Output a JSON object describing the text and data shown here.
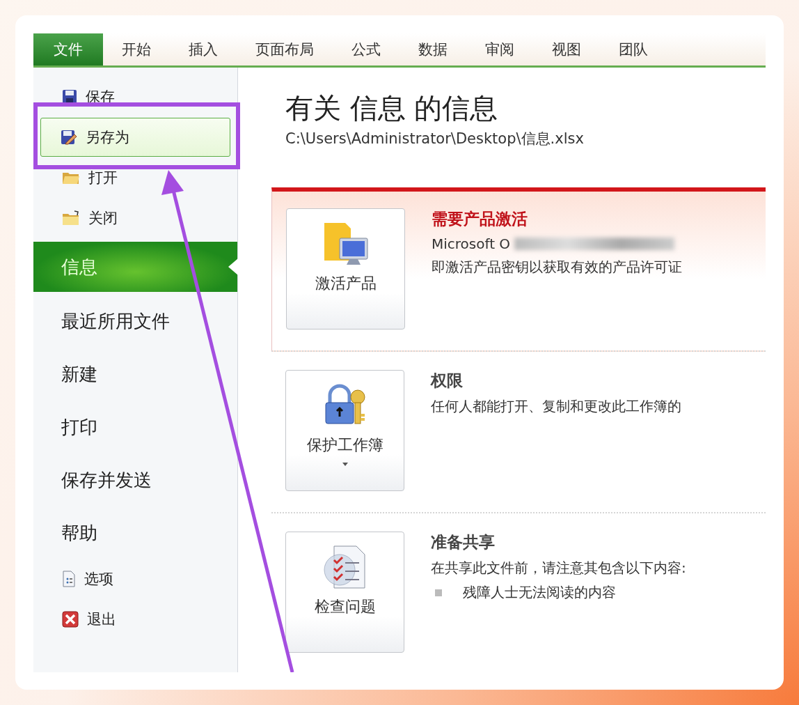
{
  "ribbon_tabs": [
    {
      "label": "文件",
      "selected": true
    },
    {
      "label": "开始",
      "selected": false
    },
    {
      "label": "插入",
      "selected": false
    },
    {
      "label": "页面布局",
      "selected": false
    },
    {
      "label": "公式",
      "selected": false
    },
    {
      "label": "数据",
      "selected": false
    },
    {
      "label": "审阅",
      "selected": false
    },
    {
      "label": "视图",
      "selected": false
    },
    {
      "label": "团队",
      "selected": false
    }
  ],
  "sidebar": {
    "items": [
      {
        "kind": "command",
        "label": "保存",
        "selected": false,
        "highlighted": false
      },
      {
        "kind": "command",
        "label": "另存为",
        "selected": false,
        "highlighted": true
      },
      {
        "kind": "command",
        "label": "打开",
        "selected": false,
        "highlighted": false
      },
      {
        "kind": "command",
        "label": "关闭",
        "selected": false,
        "highlighted": false
      },
      {
        "kind": "page",
        "label": "信息",
        "selected": true,
        "highlighted": false
      },
      {
        "kind": "page",
        "label": "最近所用文件",
        "selected": false,
        "highlighted": false
      },
      {
        "kind": "page",
        "label": "新建",
        "selected": false,
        "highlighted": false
      },
      {
        "kind": "page",
        "label": "打印",
        "selected": false,
        "highlighted": false
      },
      {
        "kind": "page",
        "label": "保存并发送",
        "selected": false,
        "highlighted": false
      },
      {
        "kind": "page",
        "label": "帮助",
        "selected": false,
        "highlighted": false
      },
      {
        "kind": "command",
        "label": "选项",
        "selected": false,
        "highlighted": false
      },
      {
        "kind": "command",
        "label": "退出",
        "selected": false,
        "highlighted": false
      }
    ]
  },
  "info": {
    "title": "有关 信息 的信息",
    "path": "C:\\Users\\Administrator\\Desktop\\信息.xlsx",
    "sections": [
      {
        "button_label": "激活产品",
        "has_dropdown": false,
        "warning": true,
        "heading": "需要产品激活",
        "lines": [
          "Microsoft O",
          "即激活产品密钥以获取有效的产品许可证"
        ],
        "redacted": true
      },
      {
        "button_label": "保护工作簿",
        "has_dropdown": true,
        "warning": false,
        "heading": "权限",
        "lines": [
          "任何人都能打开、复制和更改此工作簿的"
        ],
        "redacted": false
      },
      {
        "button_label": "检查问题",
        "has_dropdown": false,
        "warning": false,
        "heading": "准备共享",
        "lines": [
          "在共享此文件前，请注意其包含以下内容:"
        ],
        "redacted": false,
        "bullets": [
          "残障人士无法阅读的内容"
        ]
      }
    ]
  }
}
